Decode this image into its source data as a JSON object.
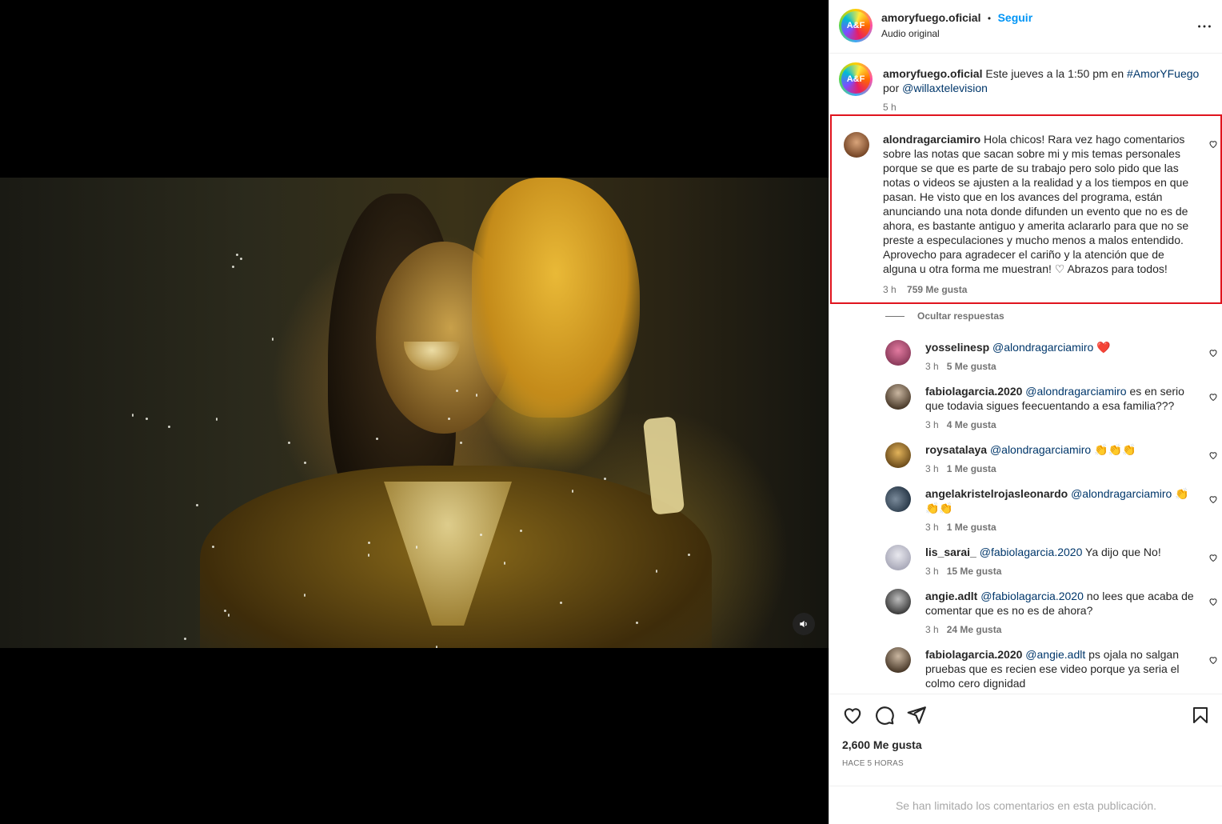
{
  "post": {
    "username": "amoryfuego.oficial",
    "follow_label": "Seguir",
    "separator": "•",
    "audio": "Audio original",
    "more_icon": "more-horizontal-icon"
  },
  "caption": {
    "username": "amoryfuego.oficial",
    "text_a": "Este jueves a la 1:50 pm en",
    "hashtag": "#AmorYFuego",
    "text_b": "por",
    "mention": "@willaxtelevision",
    "time": "5 h"
  },
  "main_comment": {
    "username": "alondragarciamiro",
    "text_a": "Hola chicos! Rara vez hago comentarios sobre las notas que sacan sobre mi y mis temas personales porque se que es parte de su trabajo pero solo pido que las notas o videos se ajusten a la realidad y a los tiempos en que pasan. He visto que en los avances del programa, están anunciando una nota donde difunden un evento que no es de ahora, es bastante antiguo y amerita aclararlo para que no se preste a especulaciones y mucho menos a malos entendido. Aprovecho para agradecer el cariño y la atención que de alguna u otra forma me muestran!",
    "emoji": "♡",
    "text_b": "Abrazos para todos!",
    "time": "3 h",
    "likes": "759 Me gusta"
  },
  "hide_replies_label": "Ocultar respuestas",
  "replies": [
    {
      "username": "yosselinesp",
      "mention": "@alondragarciamiro",
      "text": "",
      "emoji": "❤️",
      "time": "3 h",
      "likes": "5 Me gusta"
    },
    {
      "username": "fabiolagarcia.2020",
      "mention": "@alondragarciamiro",
      "text": "es en serio que todavia sigues feecuentando a esa familia???",
      "emoji": "",
      "time": "3 h",
      "likes": "4 Me gusta"
    },
    {
      "username": "roysatalaya",
      "mention": "@alondragarciamiro",
      "text": "",
      "emoji": "👏👏👏",
      "time": "3 h",
      "likes": "1 Me gusta"
    },
    {
      "username": "angelakristelrojasleonardo",
      "mention": "@alondragarciamiro",
      "text": "",
      "emoji": "👏 👏👏",
      "time": "3 h",
      "likes": "1 Me gusta"
    },
    {
      "username": "lis_sarai_",
      "mention": "@fabiolagarcia.2020",
      "text": "Ya dijo que No!",
      "emoji": "",
      "time": "3 h",
      "likes": "15 Me gusta"
    },
    {
      "username": "angie.adlt",
      "mention": "@fabiolagarcia.2020",
      "text": "no lees que acaba de comentar que es no es de ahora?",
      "emoji": "",
      "time": "3 h",
      "likes": "24 Me gusta"
    },
    {
      "username": "fabiolagarcia.2020",
      "mention": "@angie.adlt",
      "text": "ps ojala no salgan pruebas que es recien ese video porque ya seria el colmo cero dignidad",
      "emoji": "",
      "time": "",
      "likes": ""
    }
  ],
  "footer": {
    "likes": "2,600 Me gusta",
    "ago": "HACE 5 HORAS",
    "limited": "Se han limitado los comentarios en esta publicación."
  },
  "icons": [
    "heart-icon",
    "comment-icon",
    "share-icon",
    "save-icon",
    "volume-icon"
  ],
  "colors": {
    "accent": "#0095f6",
    "highlight_border": "#e0141e",
    "link": "#00376b",
    "muted": "#737373"
  }
}
